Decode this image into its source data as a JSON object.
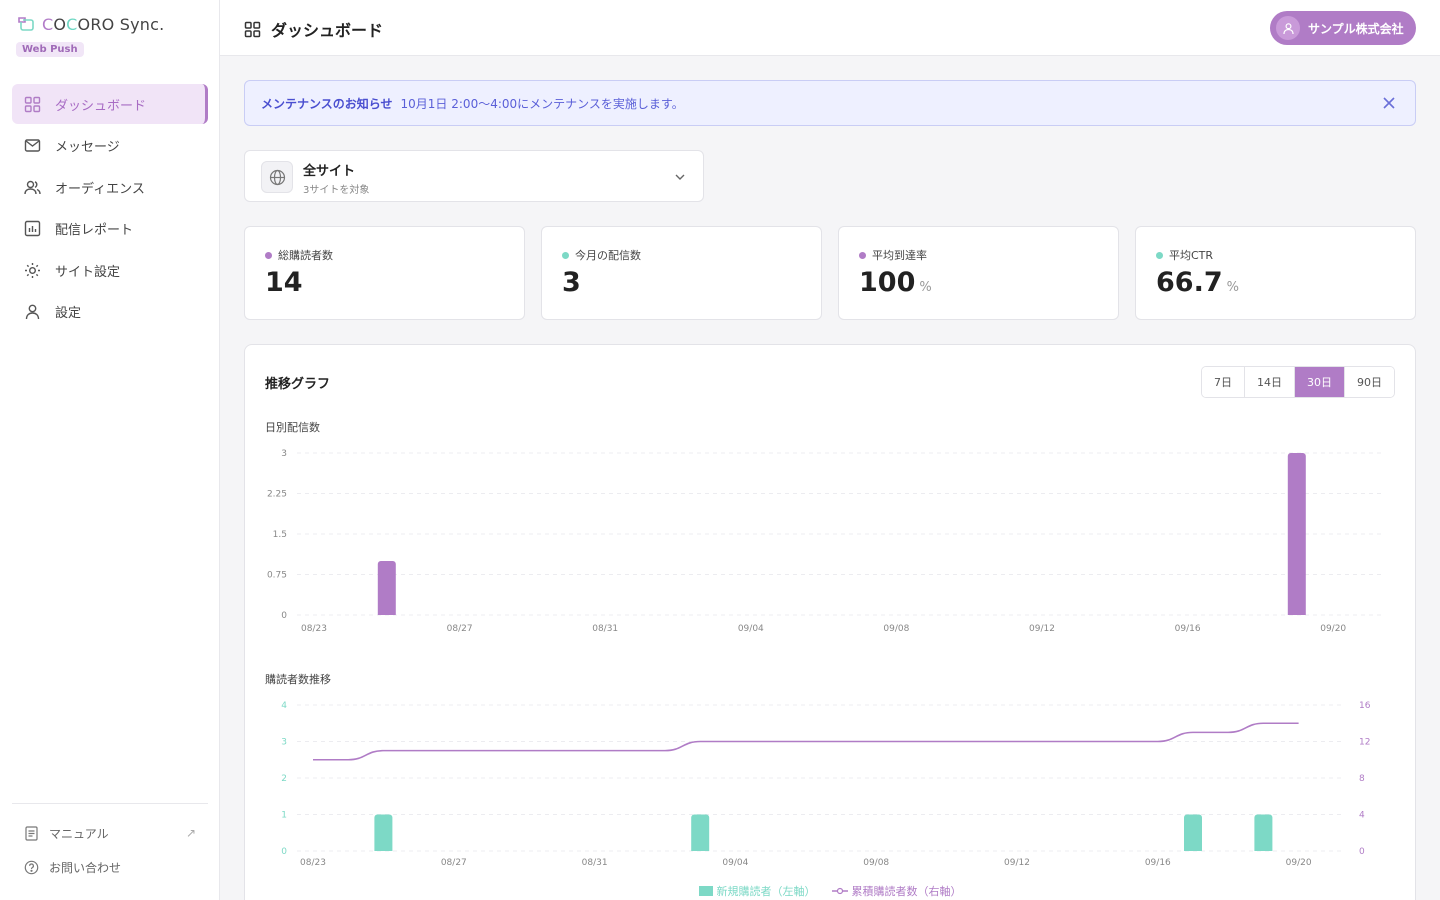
{
  "brand": {
    "logo_parts": [
      "C",
      "O",
      "C",
      "ORO Sync."
    ],
    "badge": "Web Push"
  },
  "sidebar": {
    "items": [
      {
        "label": "ダッシュボード",
        "icon": "grid-icon"
      },
      {
        "label": "メッセージ",
        "icon": "mail-icon"
      },
      {
        "label": "オーディエンス",
        "icon": "users-icon"
      },
      {
        "label": "配信レポート",
        "icon": "bar-report-icon"
      },
      {
        "label": "サイト設定",
        "icon": "sun-gear-icon"
      },
      {
        "label": "設定",
        "icon": "user-icon"
      }
    ],
    "bottom": [
      {
        "label": "マニュアル",
        "icon": "document-icon",
        "ext": "↗"
      },
      {
        "label": "お問い合わせ",
        "icon": "help-circle-icon"
      }
    ]
  },
  "header": {
    "title": "ダッシュボード",
    "account": "サンプル株式会社"
  },
  "banner": {
    "title": "メンテナンスのお知らせ",
    "text": "10月1日 2:00〜4:00にメンテナンスを実施します。"
  },
  "site_selector": {
    "name": "全サイト",
    "sub": "3サイトを対象"
  },
  "stats": [
    {
      "label": "総購読者数",
      "value": "14",
      "unit": "",
      "color": "#b07cc6"
    },
    {
      "label": "今月の配信数",
      "value": "3",
      "unit": "",
      "color": "#7dd9c6"
    },
    {
      "label": "平均到達率",
      "value": "100",
      "unit": "%",
      "color": "#b07cc6"
    },
    {
      "label": "平均CTR",
      "value": "66.7",
      "unit": "%",
      "color": "#7dd9c6"
    }
  ],
  "panel": {
    "title": "推移グラフ",
    "ranges": [
      "7日",
      "14日",
      "30日",
      "90日"
    ],
    "active_range": "30日"
  },
  "colors": {
    "purple": "#b07cc6",
    "teal": "#7dd9c6"
  },
  "chart_data": [
    {
      "type": "bar",
      "title": "日別配信数",
      "x_tick_labels": [
        "08/23",
        "08/27",
        "08/31",
        "09/04",
        "09/08",
        "09/12",
        "09/16",
        "09/20"
      ],
      "points": [
        {
          "date": "08/25",
          "value": 1
        },
        {
          "date": "09/19",
          "value": 3
        }
      ],
      "yticks": [
        "0",
        "0.75",
        "1.5",
        "2.25",
        "3"
      ],
      "ylim": [
        0,
        3
      ],
      "grid": true
    },
    {
      "type": "bar",
      "title": "購読者数推移",
      "x_tick_labels": [
        "08/23",
        "08/27",
        "08/31",
        "09/04",
        "09/08",
        "09/12",
        "09/16",
        "09/20"
      ],
      "series": [
        {
          "name": "新規購読者（左軸）",
          "axis": "left",
          "kind": "bar",
          "points": [
            {
              "date": "08/25",
              "value": 1
            },
            {
              "date": "09/03",
              "value": 1
            },
            {
              "date": "09/17",
              "value": 1
            },
            {
              "date": "09/19",
              "value": 1
            }
          ]
        },
        {
          "name": "累積購読者数（右軸）",
          "axis": "right",
          "kind": "line",
          "points": [
            {
              "date": "08/23",
              "value": 10
            },
            {
              "date": "08/24",
              "value": 10
            },
            {
              "date": "08/25",
              "value": 11
            },
            {
              "date": "09/02",
              "value": 11
            },
            {
              "date": "09/03",
              "value": 12
            },
            {
              "date": "09/16",
              "value": 12
            },
            {
              "date": "09/17",
              "value": 13
            },
            {
              "date": "09/18",
              "value": 13
            },
            {
              "date": "09/19",
              "value": 14
            },
            {
              "date": "09/20",
              "value": 14
            }
          ]
        }
      ],
      "left_yticks": [
        "0",
        "1",
        "2",
        "3",
        "4"
      ],
      "right_yticks": [
        "0",
        "4",
        "8",
        "12",
        "16"
      ],
      "left_ylim": [
        0,
        4
      ],
      "right_ylim": [
        0,
        16
      ],
      "grid": true
    }
  ]
}
